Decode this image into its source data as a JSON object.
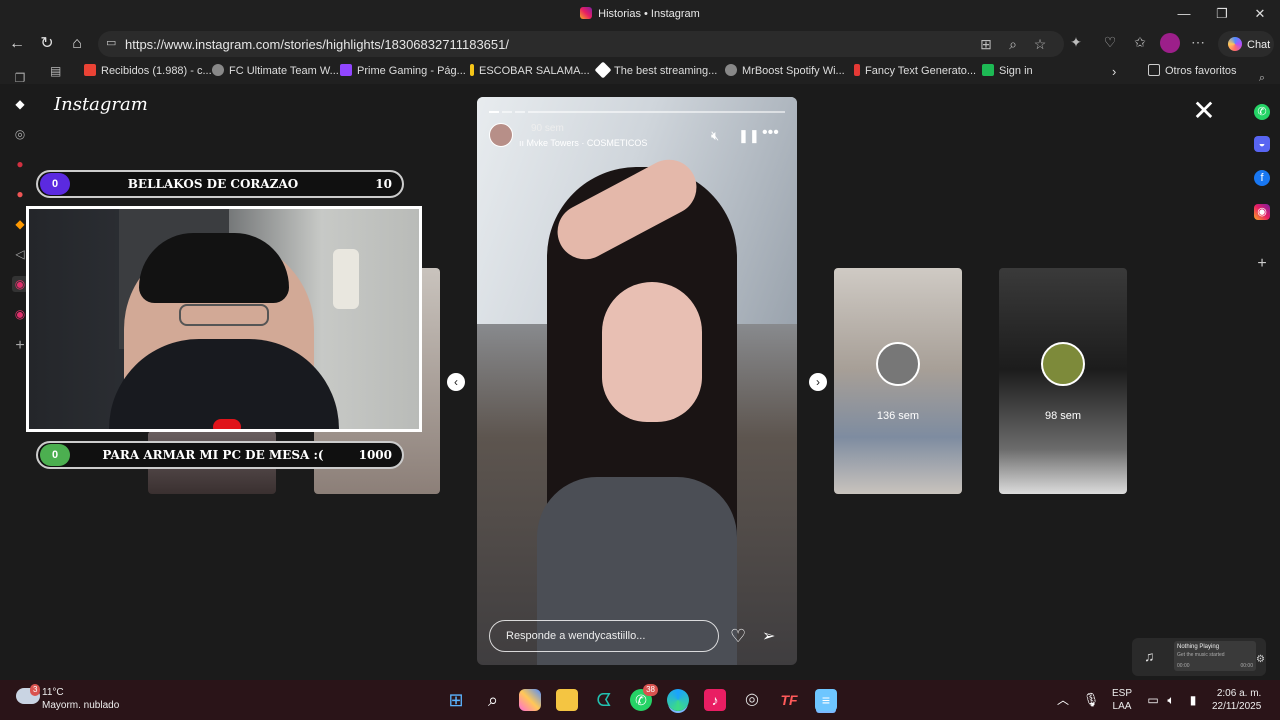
{
  "window": {
    "title": "Historias • Instagram",
    "minimize": "—",
    "maximize": "❐",
    "close": "✕"
  },
  "address_bar": {
    "url": "https://www.instagram.com/stories/highlights/18306832711183651/"
  },
  "chat_button": {
    "label": "Chat"
  },
  "bookmarks": [
    {
      "label": "Recibidos (1.988) - c...",
      "icon_color": "#ea4335"
    },
    {
      "label": "FC Ultimate Team W...",
      "icon_color": "#888888"
    },
    {
      "label": "Prime Gaming - Pág...",
      "icon_color": "#9146ff"
    },
    {
      "label": "ESCOBAR SALAMA...",
      "icon_color": "#f5c518"
    },
    {
      "label": "The best streaming...",
      "icon_color": "#ffffff"
    },
    {
      "label": "MrBoost Spotify Wi...",
      "icon_color": "#888888"
    },
    {
      "label": "Fancy Text Generato...",
      "icon_color": "#e53935"
    },
    {
      "label": "Sign in",
      "icon_color": "#1db954"
    }
  ],
  "other_favorites": "Otros favoritos",
  "instagram": {
    "logo": "Instagram",
    "close": "✕",
    "story": {
      "time": "90 sem",
      "music": "Mvke Towers · COSMETICOS",
      "reply_placeholder": "Responde a wendycastiillo...",
      "progress_segments": 4,
      "active_segment": 1
    },
    "next_stories": [
      {
        "label": "136 sem"
      },
      {
        "label": "98 sem"
      }
    ]
  },
  "stream_overlay": {
    "top_bar": {
      "left": "0",
      "label": "BELLAKOS DE CORAZAO",
      "right": "10",
      "color": "#5b2ae0"
    },
    "bottom_bar": {
      "left": "0",
      "label": "PARA ARMAR MI PC DE MESA :(",
      "right": "1000",
      "color": "#4caf50"
    }
  },
  "media_widget": {
    "title": "Nothing Playing",
    "subtitle": "Get the music started",
    "time_start": "00:00",
    "time_end": "00:00"
  },
  "taskbar": {
    "weather": {
      "temp": "11°C",
      "desc": "Mayorm. nublado",
      "badge": "3"
    },
    "whatsapp_badge": "38",
    "lang": {
      "line1": "ESP",
      "line2": "LAA"
    },
    "clock": {
      "time": "2:06 a. m.",
      "date": "22/11/2025"
    }
  }
}
